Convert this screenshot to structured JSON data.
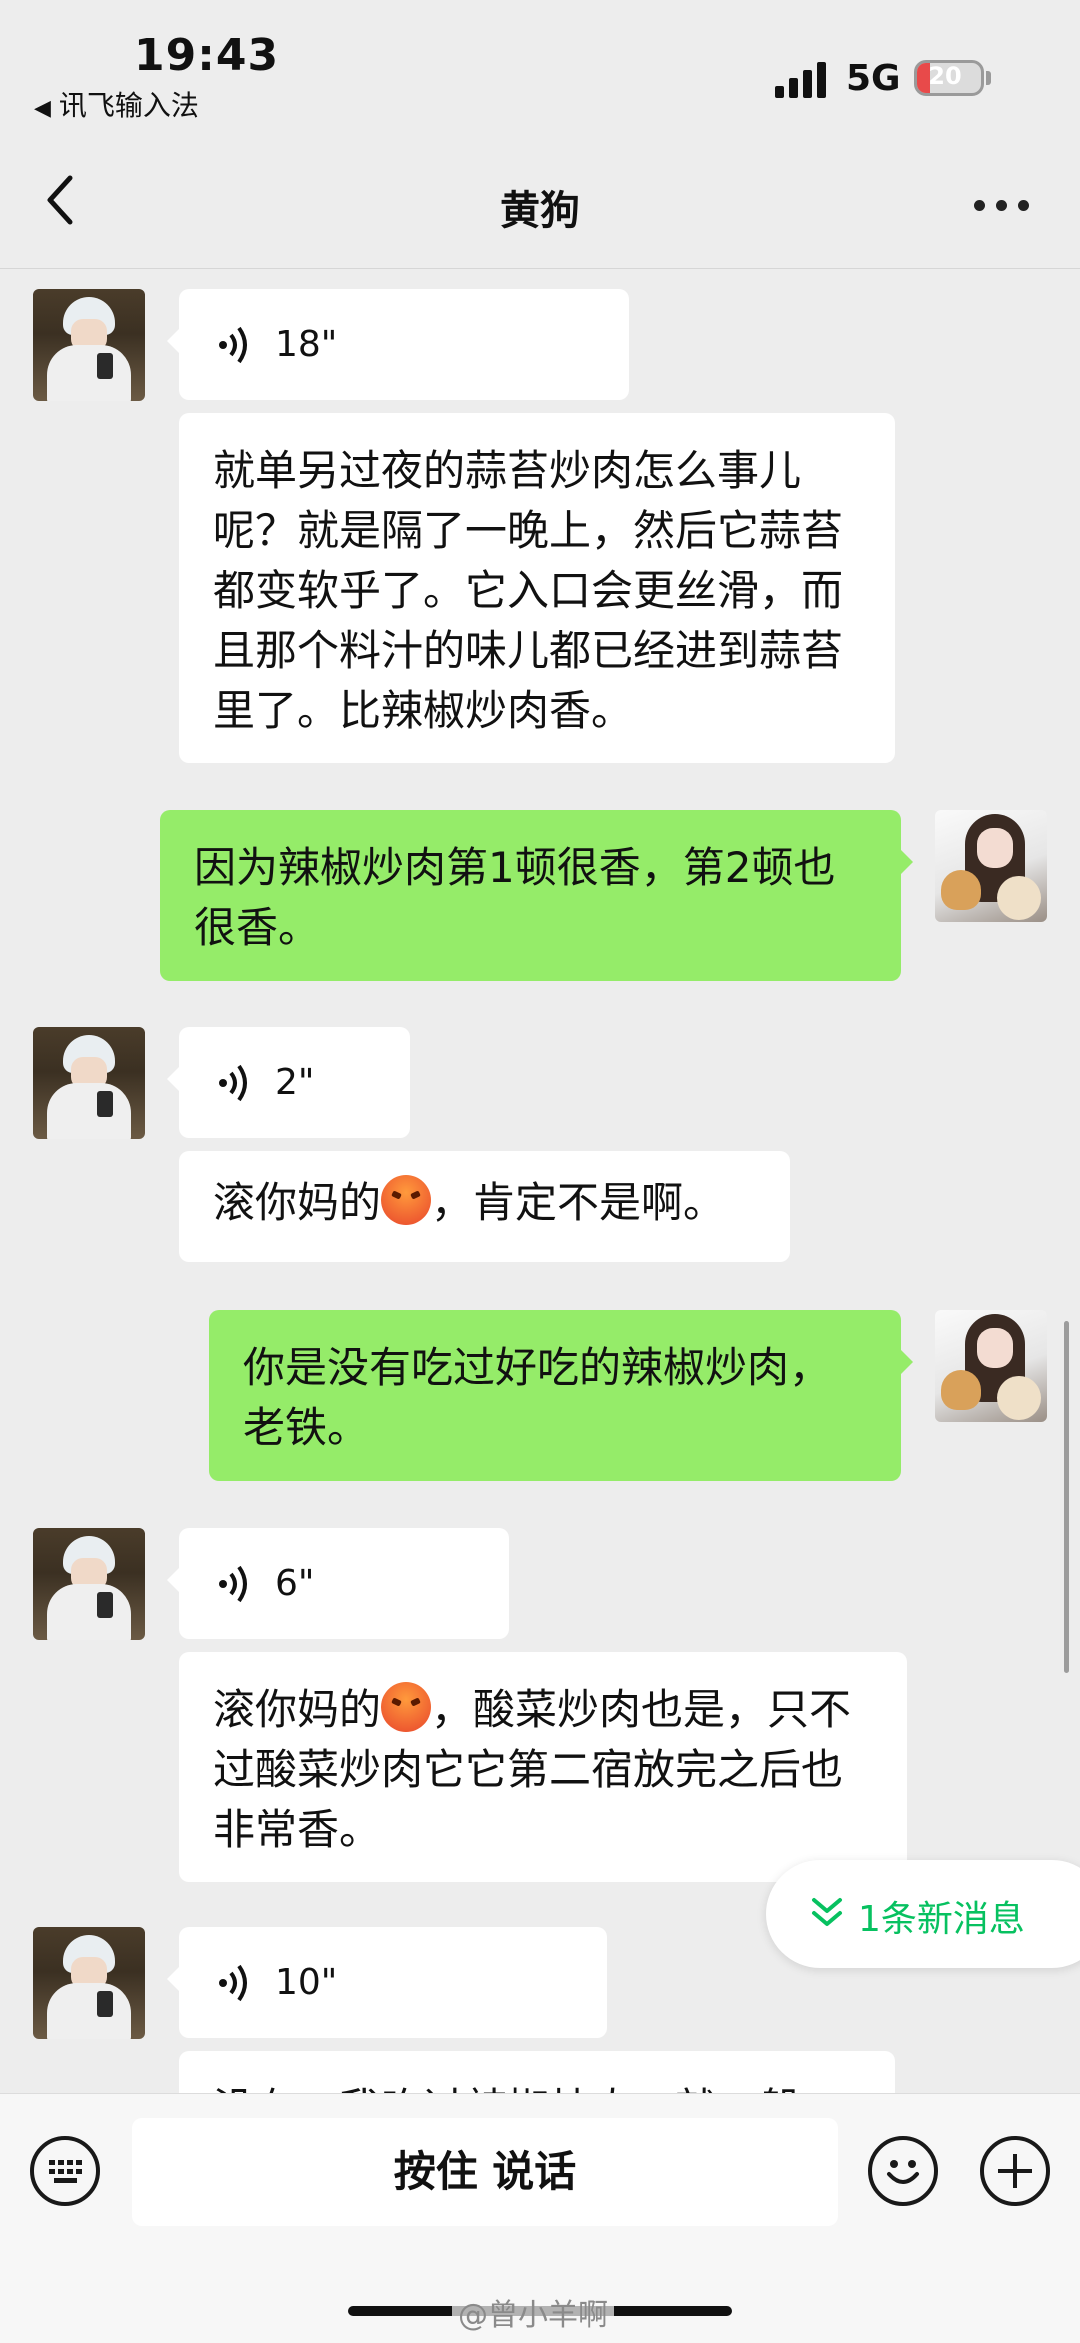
{
  "status": {
    "time": "19:43",
    "back_app": "讯飞输入法",
    "network": "5G",
    "battery": "20",
    "battery_level": 0.2
  },
  "nav": {
    "title": "黄狗"
  },
  "messages": [
    {
      "dir": "in",
      "type": "voice",
      "duration": "18\""
    },
    {
      "dir": "in",
      "type": "text",
      "text": "就单另过夜的蒜苔炒肉怎么事儿呢？就是隔了一晚上，然后它蒜苔都变软乎了。它入口会更丝滑，而且那个料汁的味儿都已经进到蒜苔里了。比辣椒炒肉香。"
    },
    {
      "dir": "out",
      "type": "text",
      "text": "因为辣椒炒肉第1顿很香，第2顿也很香。"
    },
    {
      "dir": "in",
      "type": "voice",
      "duration": "2\""
    },
    {
      "dir": "in",
      "type": "text",
      "text_before": "滚你妈的",
      "text_after": "，肯定不是啊。"
    },
    {
      "dir": "out",
      "type": "text",
      "text": "你是没有吃过好吃的辣椒炒肉，老铁。"
    },
    {
      "dir": "in",
      "type": "voice",
      "duration": "6\""
    },
    {
      "dir": "in",
      "type": "text",
      "text_before": "滚你妈的",
      "text_after": "，酸菜炒肉也是，只不过酸菜炒肉它它第二宿放完之后也非常香。"
    },
    {
      "dir": "in",
      "type": "voice",
      "duration": "10\""
    },
    {
      "dir": "in",
      "type": "text",
      "text": "没有，我吃过辣椒炒肉，就一般"
    }
  ],
  "new_message_label": "1条新消息",
  "input": {
    "hold_to_talk": "按住 说话"
  },
  "icons": {
    "keyboard": "keyboard-icon",
    "emoji": "emoji-icon",
    "plus": "plus-icon",
    "voice_wave": "voice-wave-icon",
    "angry": "angry-face-emoji"
  },
  "colors": {
    "outgoing_bubble": "#95ec69",
    "incoming_bubble": "#ffffff",
    "accent": "#07c160"
  },
  "watermark": "@曾小羊啊"
}
